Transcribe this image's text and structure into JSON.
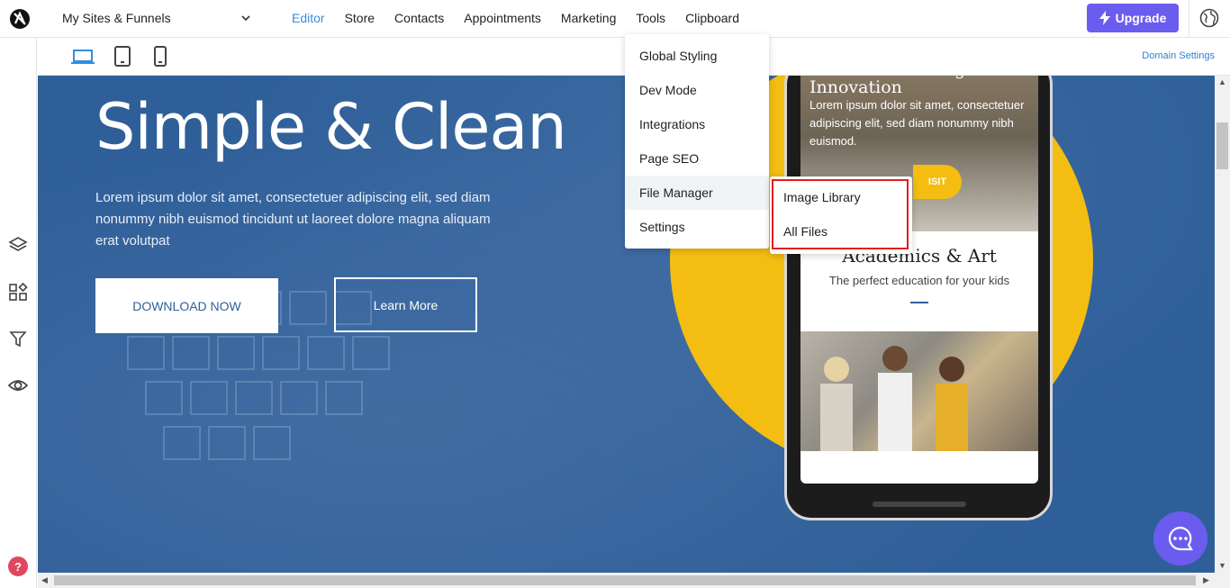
{
  "topbar": {
    "site_select": "My Sites & Funnels",
    "nav": [
      {
        "label": "Editor",
        "active": true
      },
      {
        "label": "Store"
      },
      {
        "label": "Contacts"
      },
      {
        "label": "Appointments"
      },
      {
        "label": "Marketing"
      },
      {
        "label": "Tools"
      },
      {
        "label": "Clipboard"
      }
    ],
    "upgrade_label": "Upgrade"
  },
  "devbar": {
    "domain_settings": "Domain Settings"
  },
  "hero": {
    "title": "Simple & Clean",
    "text": "Lorem ipsum dolor sit amet, consectetuer adipiscing elit, sed diam nonummy nibh euismod tincidunt ut laoreet dolore magna aliquam erat volutpat",
    "download_label": "DOWNLOAD NOW",
    "learn_label": "Learn More"
  },
  "phone": {
    "headline": "Creative Thinking &\nInnovation",
    "body": "Lorem ipsum dolor sit amet, consectetuer adipiscing elit, sed diam nonummy nibh euismod.",
    "visit": "ISIT",
    "section_title": "Academics & Art",
    "section_sub": "The perfect education for your kids"
  },
  "tools_menu": {
    "items": [
      "Global Styling",
      "Dev Mode",
      "Integrations",
      "Page SEO",
      "File Manager",
      "Settings"
    ],
    "hovered": "File Manager"
  },
  "file_manager_submenu": {
    "items": [
      "Image Library",
      "All Files"
    ]
  },
  "help_label": "?",
  "colors": {
    "accent": "#6b5cf0",
    "active_nav": "#3a8dde",
    "hero_bg": "#2f5f99",
    "yellow": "#f3bd12",
    "highlight": "#e41b1b"
  }
}
